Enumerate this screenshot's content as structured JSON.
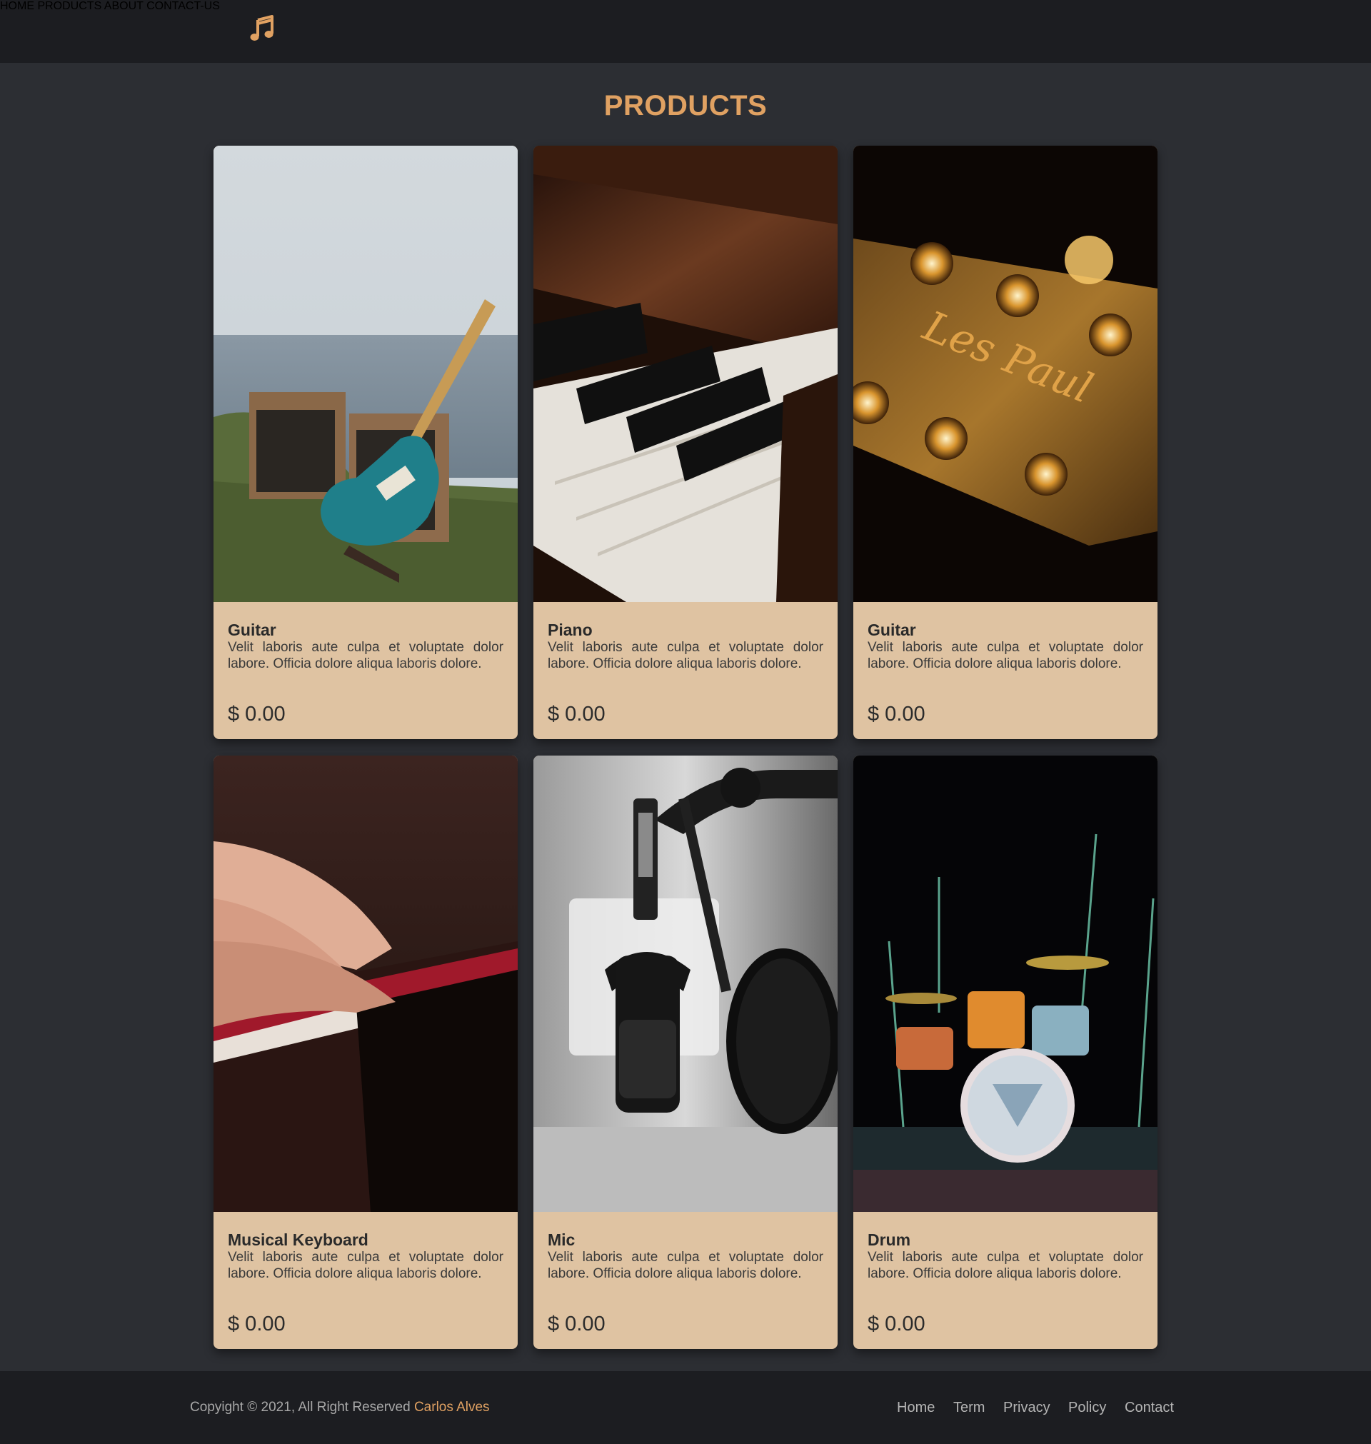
{
  "header": {
    "logo_icon": "music-note-icon",
    "nav": [
      {
        "label": "HOME"
      },
      {
        "label": "PRODUCTS"
      },
      {
        "label": "ABOUT"
      },
      {
        "label": "CONTACT-US"
      }
    ]
  },
  "main": {
    "title": "PRODUCTS",
    "products": [
      {
        "name": "Guitar",
        "description": "Velit laboris aute culpa et voluptate dolor labore. Officia dolore aliqua laboris dolore.",
        "price": "$ 0.00"
      },
      {
        "name": "Piano",
        "description": "Velit laboris aute culpa et voluptate dolor labore. Officia dolore aliqua laboris dolore.",
        "price": "$ 0.00"
      },
      {
        "name": "Guitar",
        "description": "Velit laboris aute culpa et voluptate dolor labore. Officia dolore aliqua laboris dolore.",
        "price": "$ 0.00"
      },
      {
        "name": "Musical Keyboard",
        "description": "Velit laboris aute culpa et voluptate dolor labore. Officia dolore aliqua laboris dolore.",
        "price": "$ 0.00"
      },
      {
        "name": "Mic",
        "description": "Velit laboris aute culpa et voluptate dolor labore. Officia dolore aliqua laboris dolore.",
        "price": "$ 0.00"
      },
      {
        "name": "Drum",
        "description": "Velit laboris aute culpa et voluptate dolor labore. Officia dolore aliqua laboris dolore.",
        "price": "$ 0.00"
      }
    ]
  },
  "footer": {
    "copyright": "Copyight © 2021, All Right Reserved",
    "author": "Carlos Alves",
    "links": [
      {
        "label": "Home"
      },
      {
        "label": "Term"
      },
      {
        "label": "Privacy"
      },
      {
        "label": "Policy"
      },
      {
        "label": "Contact"
      }
    ]
  },
  "colors": {
    "accent": "#e0a162",
    "header_bg": "#1c1d21",
    "page_bg": "#2c2e33",
    "card_bg": "#dfc3a2"
  }
}
